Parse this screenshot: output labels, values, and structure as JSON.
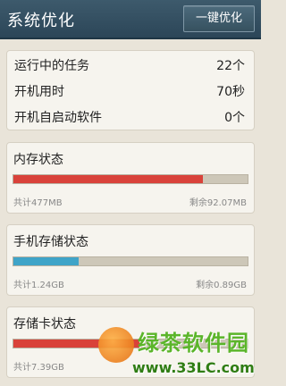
{
  "header": {
    "title": "系统优化",
    "optimize_button": "一键优化"
  },
  "tasks": [
    {
      "label": "运行中的任务",
      "value": "22个"
    },
    {
      "label": "开机用时",
      "value": "70秒"
    },
    {
      "label": "开机自启动软件",
      "value": "0个"
    }
  ],
  "memory": {
    "title": "内存状态",
    "used_fraction": 0.81,
    "total": "共计477MB",
    "remaining": "剩余92.07MB",
    "color": "#d9423a"
  },
  "phone_storage": {
    "title": "手机存储状态",
    "used_fraction": 0.28,
    "total": "共计1.24GB",
    "remaining": "剩余0.89GB",
    "color": "#3fa4c8"
  },
  "sd_card": {
    "title": "存储卡状态",
    "used_fraction": 0.55,
    "total": "共计7.39GB",
    "color": "#d9423a"
  },
  "watermark": {
    "brand": "绿茶软件园",
    "url": "www.33LC.com"
  }
}
